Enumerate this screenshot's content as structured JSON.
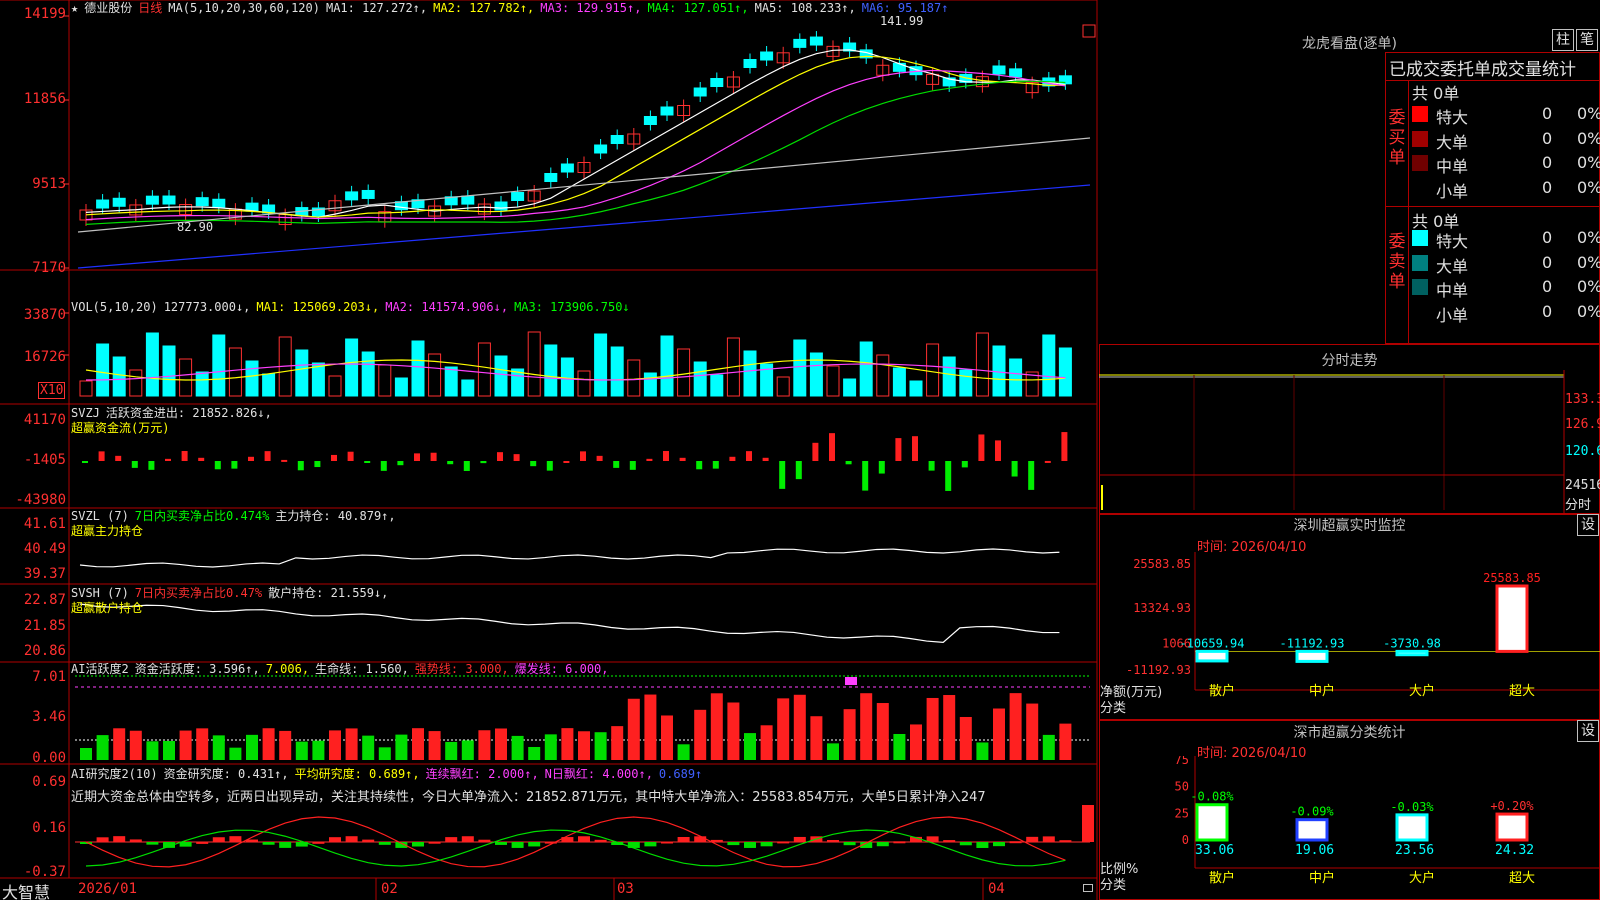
{
  "stock": {
    "name": "德业股份",
    "period": "日线"
  },
  "main_header": {
    "ma_params": "MA(5,10,20,30,60,120)",
    "ma1": "MA1: 127.272↑,",
    "ma2": "MA2: 127.782↑,",
    "ma3": "MA3: 129.915↑,",
    "ma4": "MA4: 127.051↑,",
    "ma5": "MA5: 108.233↑,",
    "ma6": "MA6: 95.187↑"
  },
  "price_annotations": {
    "high": "141.99",
    "low": "82.90"
  },
  "price_axis": [
    "14199",
    "11856",
    "9513",
    "7170"
  ],
  "vol_header": {
    "label": "VOL(5,10,20)",
    "value": "127773.000↓,",
    "ma1": "MA1: 125069.203↓,",
    "ma2": "MA2: 141574.906↓,",
    "ma3": "MA3: 173906.750↓"
  },
  "vol_axis": [
    "33870",
    "16726"
  ],
  "vol_unit": "X10",
  "svzj": {
    "label": "SVZJ",
    "text": "活跃资金进出: 21852.826↓,",
    "sub": "超赢资金流(万元)",
    "axis": [
      "41170",
      "-1405",
      "-43980"
    ]
  },
  "svzl": {
    "label": "SVZL (7)",
    "text1": "7日内买卖净占比0.474%",
    "text2": "主力持仓: 40.879↑,",
    "sub": "超赢主力持仓",
    "axis": [
      "41.61",
      "40.49",
      "39.37"
    ]
  },
  "svsh": {
    "label": "SVSH (7)",
    "text1": "7日内买卖净占比0.47%",
    "text2": "散户持仓: 21.559↓,",
    "sub": "超赢散户持仓",
    "axis": [
      "22.87",
      "21.85",
      "20.86"
    ]
  },
  "ai1": {
    "label": "AI活跃度2",
    "t1": "资金活跃度: 3.596↑,",
    "t2": "7.006,",
    "t3": "生命线: 1.560,",
    "t4": "强势线: 3.000,",
    "t5": "爆发线: 6.000,",
    "axis": [
      "7.01",
      "3.46",
      "0.00"
    ]
  },
  "ai2": {
    "label": "AI研究度2(10)",
    "t1": "资金研究度: 0.431↑,",
    "t2": "平均研究度: 0.689↑,",
    "t3": "连续飘红: 2.000↑,",
    "t4": "N日飘红: 4.000↑,",
    "t5": "0.689↑",
    "axis": [
      "0.69",
      "0.16",
      "-0.37"
    ],
    "comment": "近期大资金总体由空转多，近两日出现异动，关注其持续性，今日大单净流入：21852.871万元，其中特大单净流入：25583.854万元，大单5日累计净入247"
  },
  "date_axis": {
    "brand": "大智慧",
    "labels": [
      "2026/01",
      "02",
      "03",
      "04"
    ]
  },
  "longhu": {
    "title": "龙虎看盘(逐单)",
    "btn1": "柱",
    "btn2": "笔",
    "subtitle": "已成交委托单成交量统计",
    "buy": {
      "side": "委买单",
      "total": "共 0单",
      "rows": [
        {
          "label": "特大",
          "count": "0",
          "pct": "0%",
          "color": "#ff0000"
        },
        {
          "label": "大单",
          "count": "0",
          "pct": "0%",
          "color": "#a00000"
        },
        {
          "label": "中单",
          "count": "0",
          "pct": "0%",
          "color": "#700000"
        },
        {
          "label": "小单",
          "count": "0",
          "pct": "0%",
          "color": ""
        }
      ]
    },
    "sell": {
      "side": "委卖单",
      "total": "共 0单",
      "rows": [
        {
          "label": "特大",
          "count": "0",
          "pct": "0%",
          "color": "#00ffff"
        },
        {
          "label": "大单",
          "count": "0",
          "pct": "0%",
          "color": "#008080"
        },
        {
          "label": "中单",
          "count": "0",
          "pct": "0%",
          "color": "#006060"
        },
        {
          "label": "小单",
          "count": "0",
          "pct": "0%",
          "color": ""
        }
      ]
    }
  },
  "intraday": {
    "title": "分时走势",
    "axis": [
      "133.3",
      "126.9",
      "120.6",
      "24516"
    ],
    "unit": "分时"
  },
  "sz_monitor": {
    "title": "深圳超赢实时监控",
    "btn": "设",
    "time": "时间: 2026/04/10",
    "axis": [
      "25583.85",
      "13324.93",
      "1066",
      "-11192.93"
    ],
    "ylabel": "净额(万元)",
    "xlabel": "分类"
  },
  "sz_stats": {
    "title": "深市超赢分类统计",
    "btn": "设",
    "time": "时间: 2026/04/10",
    "axis": [
      "75",
      "50",
      "25",
      "0"
    ],
    "ylabel": "比例%",
    "xlabel": "分类"
  },
  "chart_data": [
    {
      "type": "bar",
      "title": "深圳超赢实时监控",
      "xlabel": "分类",
      "ylabel": "净额(万元)",
      "categories": [
        "散户",
        "中户",
        "大户",
        "超大"
      ],
      "values": [
        -10659.94,
        -11192.93,
        -3730.98,
        25583.85
      ],
      "labels": [
        "-10659.94",
        "-11192.93",
        "-3730.98",
        "25583.85"
      ],
      "colors": [
        "#00ffff",
        "#00ffff",
        "#00ffff",
        "#ff2020"
      ],
      "ylim": [
        -11192.93,
        25583.85
      ]
    },
    {
      "type": "bar",
      "title": "深市超赢分类统计",
      "xlabel": "分类",
      "ylabel": "比例%",
      "categories": [
        "散户",
        "中户",
        "大户",
        "超大"
      ],
      "values": [
        33.06,
        19.06,
        23.56,
        24.32
      ],
      "changes": [
        "-0.08%",
        "-0.09%",
        "-0.03%",
        "+0.20%"
      ],
      "colors": [
        "#00ff00",
        "#2040ff",
        "#00ffff",
        "#ff2020"
      ],
      "ylim": [
        0,
        75
      ]
    }
  ]
}
